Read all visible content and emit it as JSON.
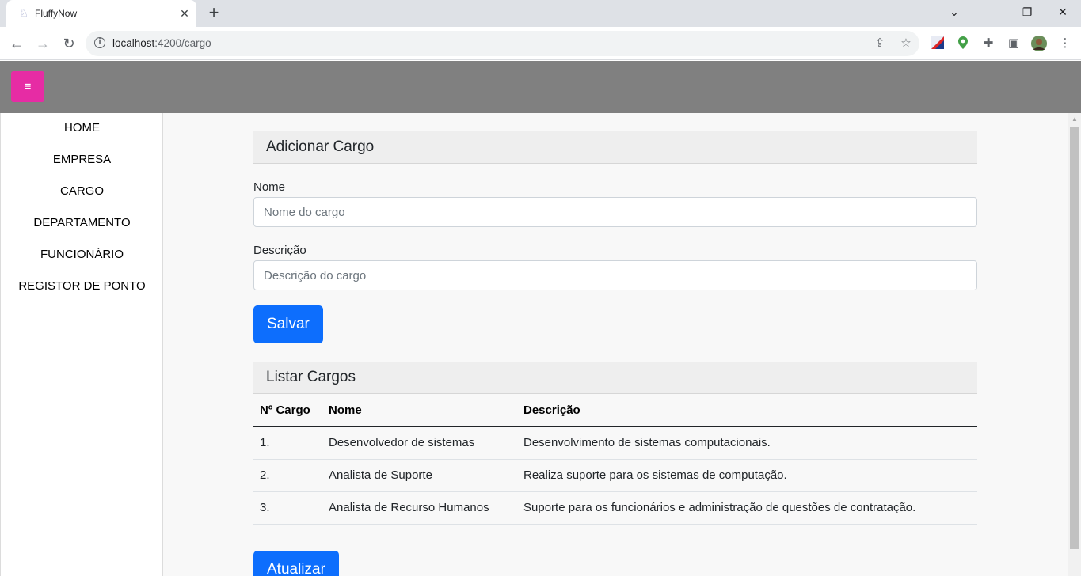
{
  "browser": {
    "tab_title": "FluffyNow",
    "tab_close": "✕",
    "new_tab": "+",
    "url_host": "localhost",
    "url_path": ":4200/cargo",
    "controls": {
      "back": "←",
      "forward": "→",
      "reload": "↻",
      "info": "i"
    },
    "window": {
      "dropdown": "⌄",
      "minimize": "—",
      "restore": "❐",
      "close": "✕"
    },
    "icons": {
      "share": "⇪",
      "star": "☆",
      "puzzle": "✚",
      "sidepanel": "▣",
      "menu": "⋮"
    }
  },
  "app": {
    "menu_button": "≡",
    "accent_color": "#e62ca4"
  },
  "sidebar": {
    "items": [
      {
        "label": "HOME"
      },
      {
        "label": "EMPRESA"
      },
      {
        "label": "CARGO"
      },
      {
        "label": "DEPARTAMENTO"
      },
      {
        "label": "FUNCIONÁRIO"
      },
      {
        "label": "REGISTOR DE PONTO"
      }
    ]
  },
  "form": {
    "title": "Adicionar Cargo",
    "name_label": "Nome",
    "name_placeholder": "Nome do cargo",
    "desc_label": "Descrição",
    "desc_placeholder": "Descrição do cargo",
    "save_button": "Salvar"
  },
  "list": {
    "title": "Listar Cargos",
    "columns": [
      "Nº Cargo",
      "Nome",
      "Descrição"
    ],
    "rows": [
      {
        "num": "1.",
        "name": "Desenvolvedor de sistemas",
        "desc": "Desenvolvimento de sistemas computacionais."
      },
      {
        "num": "2.",
        "name": "Analista de Suporte",
        "desc": "Realiza suporte para os sistemas de computação."
      },
      {
        "num": "3.",
        "name": "Analista de Recurso Humanos",
        "desc": "Suporte para os funcionários e administração de questões de contratação."
      }
    ],
    "update_button": "Atualizar"
  }
}
